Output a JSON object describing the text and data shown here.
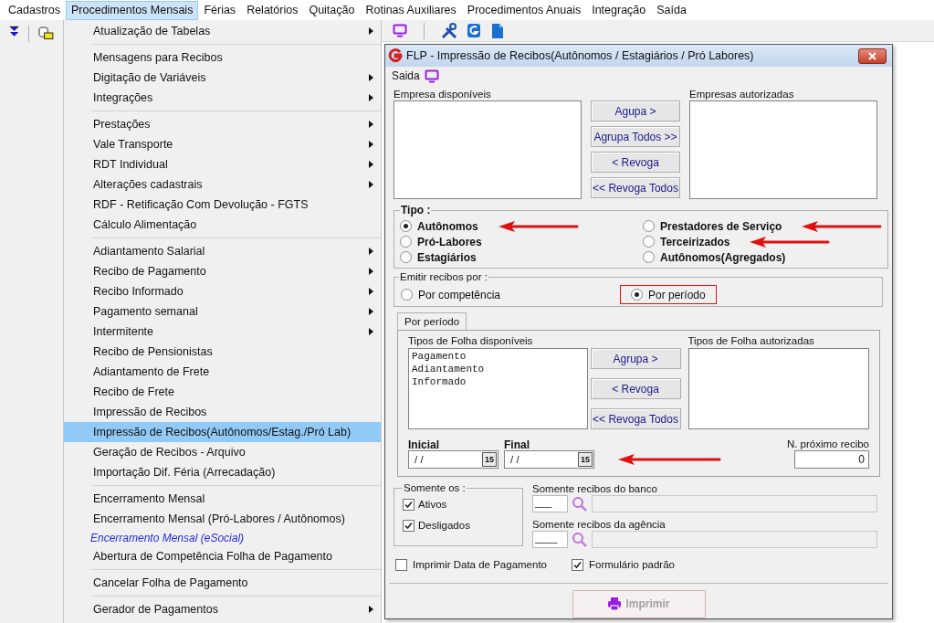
{
  "menu_bar": [
    {
      "label": "Cadastros",
      "selected": false
    },
    {
      "label": "Procedimentos Mensais",
      "selected": true
    },
    {
      "label": "Férias",
      "selected": false
    },
    {
      "label": "Relatórios",
      "selected": false
    },
    {
      "label": "Quitação",
      "selected": false
    },
    {
      "label": "Rotinas Auxiliares",
      "selected": false
    },
    {
      "label": "Procedimentos Anuais",
      "selected": false
    },
    {
      "label": "Integração",
      "selected": false
    },
    {
      "label": "Saída",
      "selected": false
    }
  ],
  "dropdown": {
    "groups": [
      [
        {
          "label": "Atualização de Tabelas",
          "submenu": true,
          "selected": false,
          "kind": "item"
        }
      ],
      [
        {
          "label": "Mensagens para Recibos",
          "submenu": false,
          "selected": false,
          "kind": "item"
        },
        {
          "label": "Digitação de Variáveis",
          "submenu": true,
          "selected": false,
          "kind": "item"
        },
        {
          "label": "Integrações",
          "submenu": true,
          "selected": false,
          "kind": "item"
        }
      ],
      [
        {
          "label": "Prestações",
          "submenu": true,
          "selected": false,
          "kind": "item"
        },
        {
          "label": "Vale Transporte",
          "submenu": true,
          "selected": false,
          "kind": "item"
        },
        {
          "label": "RDT Individual",
          "submenu": true,
          "selected": false,
          "kind": "item"
        },
        {
          "label": "Alterações cadastrais",
          "submenu": true,
          "selected": false,
          "kind": "item"
        },
        {
          "label": "RDF - Retificação Com Devolução - FGTS",
          "submenu": false,
          "selected": false,
          "kind": "item"
        },
        {
          "label": "Cálculo Alimentação",
          "submenu": false,
          "selected": false,
          "kind": "item"
        }
      ],
      [
        {
          "label": "Adiantamento Salarial",
          "submenu": true,
          "selected": false,
          "kind": "item"
        },
        {
          "label": "Recibo de Pagamento",
          "submenu": true,
          "selected": false,
          "kind": "item"
        },
        {
          "label": "Recibo Informado",
          "submenu": true,
          "selected": false,
          "kind": "item"
        },
        {
          "label": "Pagamento semanal",
          "submenu": true,
          "selected": false,
          "kind": "item"
        },
        {
          "label": "Intermitente",
          "submenu": true,
          "selected": false,
          "kind": "item"
        },
        {
          "label": "Recibo de Pensionistas",
          "submenu": false,
          "selected": false,
          "kind": "item"
        },
        {
          "label": "Adiantamento de Frete",
          "submenu": false,
          "selected": false,
          "kind": "item"
        },
        {
          "label": "Recibo de Frete",
          "submenu": false,
          "selected": false,
          "kind": "item"
        },
        {
          "label": "Impressão de Recibos",
          "submenu": false,
          "selected": false,
          "kind": "item"
        },
        {
          "label": "Impressão de Recibos(Autônomos/Estag./Pró Lab)",
          "submenu": false,
          "selected": true,
          "kind": "item"
        },
        {
          "label": "Geração de Recibos - Arquivo",
          "submenu": false,
          "selected": false,
          "kind": "item"
        },
        {
          "label": "Importação Dif. Féria (Arrecadação)",
          "submenu": false,
          "selected": false,
          "kind": "item"
        }
      ],
      [
        {
          "label": "Encerramento Mensal",
          "submenu": false,
          "selected": false,
          "kind": "item"
        },
        {
          "label": "Encerramento Mensal (Pró-Labores / Autônomos)",
          "submenu": false,
          "selected": false,
          "kind": "item"
        },
        {
          "label": "Encerramento Mensal (eSocial)",
          "submenu": false,
          "selected": false,
          "kind": "special"
        },
        {
          "label": "Abertura de Competência Folha de Pagamento",
          "submenu": false,
          "selected": false,
          "kind": "item"
        }
      ],
      [
        {
          "label": "Cancelar Folha de Pagamento",
          "submenu": false,
          "selected": false,
          "kind": "item"
        }
      ],
      [
        {
          "label": "Gerador de Pagamentos",
          "submenu": true,
          "selected": false,
          "kind": "item"
        }
      ]
    ]
  },
  "dialog": {
    "title": "FLP - Impressão de Recibos(Autônomos / Estagiários / Pró Labores)",
    "menu": [
      "Saida"
    ],
    "empresas": {
      "available_label": "Empresa disponíveis",
      "authorized_label": "Empresas autorizadas",
      "buttons": [
        "Agupa >",
        "Agrupa Todos >>",
        "< Revoga",
        "<< Revoga Todos"
      ]
    },
    "tipo": {
      "label": "Tipo :",
      "options": [
        {
          "label": "Autônomos",
          "selected": true,
          "annotated": true
        },
        {
          "label": "Pró-Labores",
          "selected": false,
          "annotated": false
        },
        {
          "label": "Estagiários",
          "selected": false,
          "annotated": false
        },
        {
          "label": "Prestadores de Serviço",
          "selected": false,
          "annotated": true
        },
        {
          "label": "Terceirizados",
          "selected": false,
          "annotated": true
        },
        {
          "label": "Autônomos(Agregados)",
          "selected": false,
          "annotated": false
        }
      ]
    },
    "emitir": {
      "label": "Emitir recibos por :",
      "options": [
        {
          "label": "Por competência",
          "selected": false,
          "annotated": false
        },
        {
          "label": "Por período",
          "selected": true,
          "annotated": true
        }
      ]
    },
    "tab": {
      "label": "Por período",
      "selected": true
    },
    "folha": {
      "available_label": "Tipos de Folha disponíveis",
      "available": [
        "Pagamento",
        "Adiantamento",
        "Informado"
      ],
      "authorized_label": "Tipos de Folha autorizadas",
      "buttons": [
        "Agrupa >",
        "< Revoga",
        "<< Revoga Todos"
      ]
    },
    "dates": {
      "annotated": true,
      "fields": [
        {
          "label": "Inicial",
          "value": "/ /",
          "calendar_day": "15"
        },
        {
          "label": "Final",
          "value": "/ /",
          "calendar_day": "15"
        }
      ]
    },
    "next_receipt": {
      "label": "N. próximo recibo",
      "value": "0"
    },
    "somente": {
      "label": "Somente os :",
      "options": [
        {
          "label": "Ativos",
          "checked": true
        },
        {
          "label": "Desligados",
          "checked": true
        }
      ]
    },
    "bank": {
      "label": "Somente recibos do banco",
      "value": "___"
    },
    "agency": {
      "label": "Somente recibos da agência",
      "value": "____"
    },
    "options": [
      {
        "label": "Imprimir Data de Pagamento",
        "checked": false
      },
      {
        "label": "Formulário padrão",
        "checked": true
      }
    ],
    "print_button": {
      "label": "Imprimir",
      "disabled": true
    }
  }
}
